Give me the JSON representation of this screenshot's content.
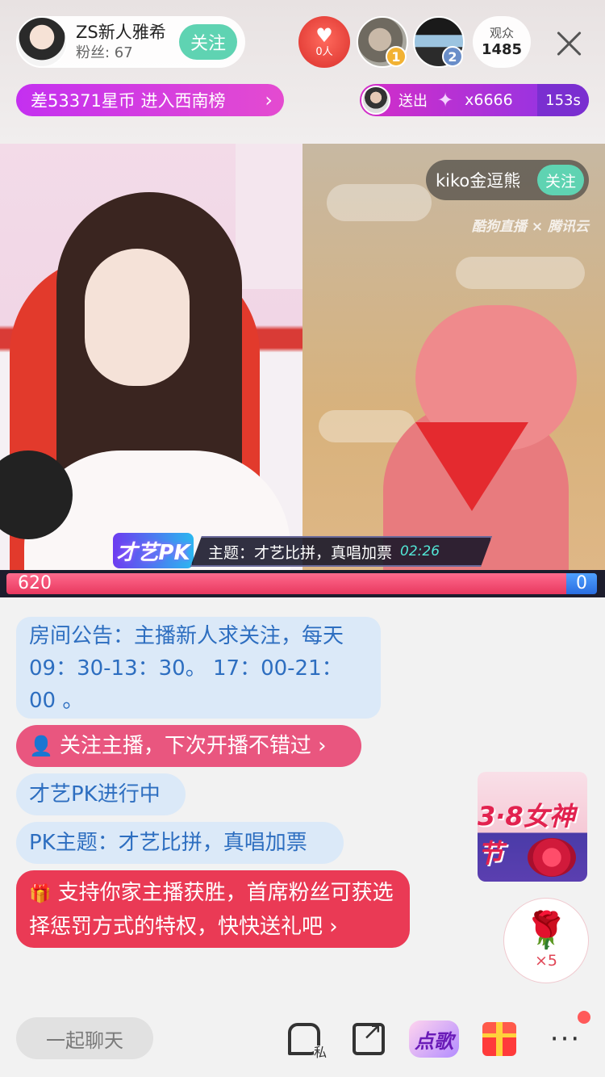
{
  "host": {
    "name": "ZS新人雅希",
    "fans": "粉丝: 67",
    "follow_label": "关注"
  },
  "guard": {
    "count": "0人",
    "icon": "heart-wings-icon"
  },
  "viewers": [
    {
      "rank": "1"
    },
    {
      "rank": "2"
    }
  ],
  "audience": {
    "label": "观众",
    "count": "1485"
  },
  "rank_banner": {
    "text": "差53371星币 进入西南榜",
    "arrow": "›"
  },
  "gift_ticker": {
    "send": "送出",
    "gift_icon": "paper-crane-icon",
    "count": "x6666",
    "time": "153s"
  },
  "guest": {
    "name": "kiko金逗熊",
    "follow_label": "关注"
  },
  "watermark": "酷狗直播 × 腾讯云",
  "pk": {
    "logo": "才艺PK",
    "topic": "主题：才艺比拼，真唱加票",
    "timer": "02:26",
    "score_left": "620",
    "score_right": "0",
    "colors": {
      "left": "#e8385f",
      "right": "#2a6de0"
    }
  },
  "chat": {
    "notice": "房间公告：主播新人求关注，每天09：30-13：30。 17：00-21：00 。",
    "follow_tip": "关注主播，下次开播不错过 ›",
    "pk_status": "才艺PK进行中",
    "pk_topic": "PK主题：才艺比拼，真唱加票",
    "support_tip": "支持你家主播获胜，首席粉丝可获选择惩罚方式的特权，快快送礼吧 ›"
  },
  "promo": {
    "title": "3·8女神节"
  },
  "rose": {
    "count": "×5"
  },
  "bottom_bar": {
    "chat_placeholder": "一起聊天",
    "private_label": "私",
    "song_label": "点歌",
    "more": "···"
  }
}
